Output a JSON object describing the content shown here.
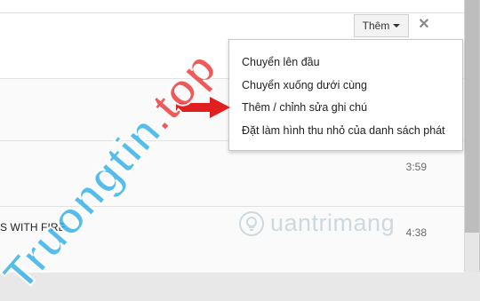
{
  "toolbar": {
    "more_label": "Thêm",
    "close_label": "✕"
  },
  "menu": {
    "items": [
      "Chuyển lên đầu",
      "Chuyển xuống dưới cùng",
      "Thêm / chỉnh sửa ghi chú",
      "Đặt làm hình thu nhỏ của danh sách phát"
    ]
  },
  "rows": [
    {
      "title": "",
      "duration": ""
    },
    {
      "title": "",
      "duration": ""
    },
    {
      "title": "",
      "duration": "3:59"
    },
    {
      "title": "S WITH FIRE",
      "duration": "4:38"
    }
  ],
  "watermarks": {
    "brand": "Truongtin.top",
    "second": "Quantrimang"
  },
  "colors": {
    "arrow": "#e02020",
    "watermark_blue": "#28aae6",
    "watermark_red": "#eb3c3c"
  }
}
